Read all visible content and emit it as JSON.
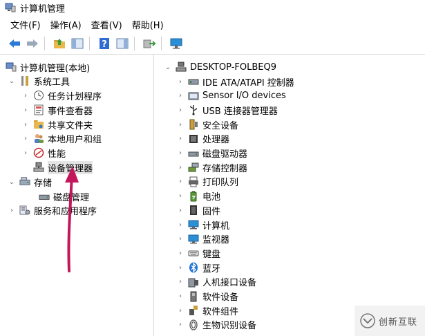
{
  "window": {
    "title": "计算机管理",
    "icon": "computer-management-icon"
  },
  "menu": [
    "文件(F)",
    "操作(A)",
    "查看(V)",
    "帮助(H)"
  ],
  "toolbar": {
    "buttons": [
      "back-arrow-icon",
      "forward-arrow-icon",
      "up-folder-icon",
      "show-hide-tree-icon",
      "help-icon",
      "properties-icon",
      "export-list-icon",
      "monitor-icon"
    ]
  },
  "left_tree": {
    "root": "计算机管理(本地)",
    "system_tools": "系统工具",
    "system_items": [
      "任务计划程序",
      "事件查看器",
      "共享文件夹",
      "本地用户和组",
      "性能",
      "设备管理器"
    ],
    "storage": "存储",
    "storage_items": [
      "磁盘管理"
    ],
    "services": "服务和应用程序",
    "selected": "设备管理器"
  },
  "device_tree": {
    "computer": "DESKTOP-FOLBEQ9",
    "categories": [
      {
        "label": "IDE ATA/ATAPI 控制器",
        "icon": "ide-controller-icon"
      },
      {
        "label": "Sensor I/O devices",
        "icon": "sensor-device-icon"
      },
      {
        "label": "USB 连接器管理器",
        "icon": "usb-connector-icon"
      },
      {
        "label": "安全设备",
        "icon": "security-device-icon"
      },
      {
        "label": "处理器",
        "icon": "processor-icon"
      },
      {
        "label": "磁盘驱动器",
        "icon": "disk-drive-icon"
      },
      {
        "label": "存储控制器",
        "icon": "storage-controller-icon"
      },
      {
        "label": "打印队列",
        "icon": "print-queue-icon"
      },
      {
        "label": "电池",
        "icon": "battery-icon"
      },
      {
        "label": "固件",
        "icon": "firmware-icon"
      },
      {
        "label": "计算机",
        "icon": "computer-icon"
      },
      {
        "label": "监视器",
        "icon": "monitor-icon"
      },
      {
        "label": "键盘",
        "icon": "keyboard-icon"
      },
      {
        "label": "蓝牙",
        "icon": "bluetooth-icon"
      },
      {
        "label": "人机接口设备",
        "icon": "hid-icon"
      },
      {
        "label": "软件设备",
        "icon": "software-device-icon"
      },
      {
        "label": "软件组件",
        "icon": "software-component-icon"
      },
      {
        "label": "生物识别设备",
        "icon": "biometric-icon"
      }
    ]
  },
  "watermark": {
    "text": "创新互联",
    "icon": "chuangxin-logo-icon"
  },
  "colors": {
    "selection_bg": "#e5e5e5",
    "annotation_arrow": "#c2185b",
    "bluetooth": "#1e73d7"
  }
}
